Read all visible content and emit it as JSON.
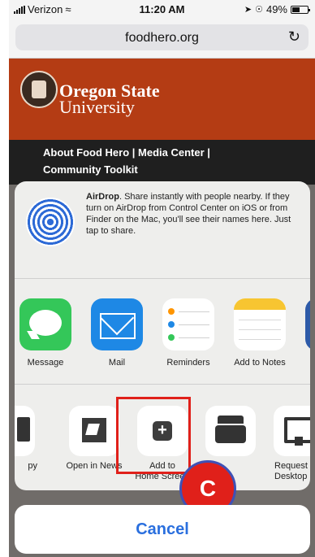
{
  "status_bar": {
    "carrier": "Verizon",
    "time": "11:20 AM",
    "battery": "49%",
    "battery_level": 0.49
  },
  "url_bar": {
    "url": "foodhero.org",
    "reload_icon": "reload-icon"
  },
  "site": {
    "logo_line1": "Oregon State",
    "logo_line2": "University",
    "nav_line1": "About Food Hero | Media Center |",
    "nav_line2": "Community Toolkit"
  },
  "airdrop": {
    "title": "AirDrop",
    "text": ". Share instantly with people nearby. If they turn on AirDrop from Control Center on iOS or from Finder on the Mac, you'll see their names here. Just tap to share."
  },
  "apps": [
    {
      "label": "Message",
      "icon": "messages-icon"
    },
    {
      "label": "Mail",
      "icon": "mail-icon"
    },
    {
      "label": "Reminders",
      "icon": "reminders-icon"
    },
    {
      "label": "Add to Notes",
      "icon": "notes-icon"
    }
  ],
  "actions": [
    {
      "label": "py",
      "icon": "copy-icon"
    },
    {
      "label": "Open in News",
      "icon": "news-icon"
    },
    {
      "label": "Add to",
      "label2": "Home Screen",
      "icon": "add-square-icon",
      "glyph": "+"
    },
    {
      "label": "",
      "icon": "print-icon"
    },
    {
      "label": "Request",
      "label2": "Desktop Site",
      "icon": "desktop-icon"
    }
  ],
  "annotation": {
    "badge_letter": "C",
    "highlight_color": "#e0201a",
    "badge_border_color": "#3f51b5"
  },
  "cancel_label": "Cancel",
  "colors": {
    "osu_orange": "#b43c14",
    "ios_blue": "#2a6fde"
  }
}
